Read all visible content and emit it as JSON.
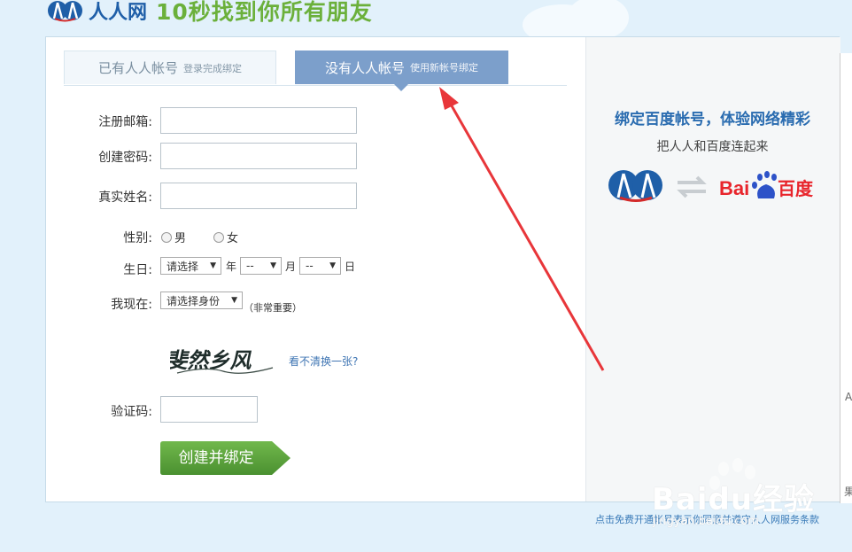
{
  "header": {
    "logo_text": "人人网",
    "slogan": "10秒找到你所有朋友"
  },
  "tabs": {
    "existing": {
      "main": "已有人人帐号",
      "sub": "登录完成绑定"
    },
    "new": {
      "main": "没有人人帐号",
      "sub": "使用新帐号绑定"
    }
  },
  "form": {
    "email_label": "注册邮箱:",
    "password_label": "创建密码:",
    "name_label": "真实姓名:",
    "gender_label": "性别:",
    "gender_male": "男",
    "gender_female": "女",
    "birthday_label": "生日:",
    "year_select": "请选择",
    "year_unit": "年",
    "month_select": "--",
    "month_unit": "月",
    "day_select": "--",
    "day_unit": "日",
    "status_label": "我现在:",
    "status_select": "请选择身份",
    "status_note": "（非常重要）",
    "captcha_text": "斐然乡风",
    "captcha_refresh": "看不清换一张?",
    "captcha_label": "验证码:",
    "submit_label": "创建并绑定"
  },
  "right": {
    "title": "绑定百度帐号，体验网络精彩",
    "subtitle": "把人人和百度连起来",
    "baidu_text": "Bai",
    "baidu_cn": "百度"
  },
  "footer": {
    "text": "点击免费开通帐号表示你同意并遵守人人网服务条款"
  },
  "watermark": {
    "text": "Baidu经验",
    "url": "jingyan.baidu.com"
  },
  "side": {
    "letter_a": "A",
    "cut_char": "果"
  },
  "colors": {
    "brand_blue": "#1f5fa8",
    "slogan_green": "#6bb03b",
    "tab_active": "#7c9fcb",
    "button_green": "#5aa23a",
    "arrow_red": "#e8363a"
  }
}
